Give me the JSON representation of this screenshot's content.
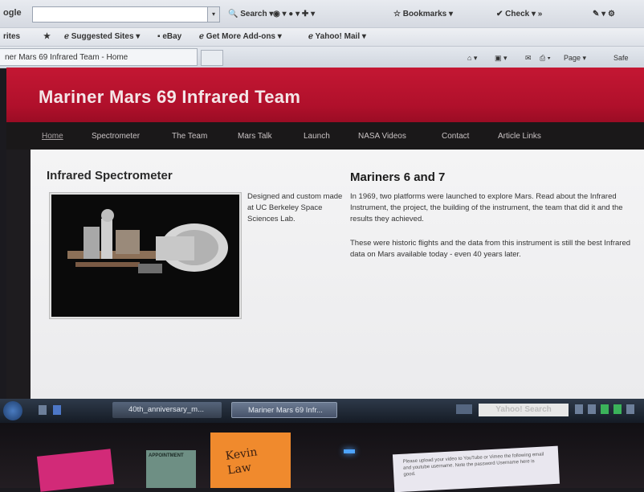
{
  "browser": {
    "search_label": "ogle",
    "toolbar": {
      "search": "Search",
      "bookmarks": "Bookmarks",
      "check": "Check"
    },
    "favorites": {
      "left": "rites",
      "suggested": "Suggested Sites",
      "ebay": "eBay",
      "addons": "Get More Add-ons",
      "yahoo_mail": "Yahoo! Mail"
    },
    "tab_title": "ner Mars 69 Infrared Team - Home",
    "command": {
      "page": "Page",
      "safety": "Safe"
    }
  },
  "site": {
    "title": "Mariner Mars 69 Infrared Team",
    "nav": [
      "Home",
      "Spectrometer",
      "The Team",
      "Mars Talk",
      "Launch",
      "NASA Videos",
      "Contact",
      "Article Links"
    ]
  },
  "content": {
    "left_heading": "Infrared Spectrometer",
    "photo_caption": "Designed and custom made at UC Berkeley Space Sciences Lab.",
    "right_heading": "Mariners 6 and 7",
    "para1": "In 1969, two platforms were launched to explore Mars. Read about the Infrared Instrument, the project, the building of the instrument, the team that did it and the results they achieved.",
    "para2": "These were historic flights and the data from this instrument is still the best Infrared data on Mars available today - even 40 years later."
  },
  "taskbar": {
    "item1": "40th_anniversary_m...",
    "item2": "Mariner Mars 69 Infr...",
    "yahoo_search": "Yahoo! Search"
  },
  "desk": {
    "note_orange": "Kevin\nLaw",
    "note_green": "APPOINTMENT",
    "note_white": "Please upload your video to YouTube or Vimeo the following email and youtube username. Note the password Username here is good."
  },
  "colors": {
    "header_red": "#b0102b",
    "nav_dark": "#1a1819"
  }
}
